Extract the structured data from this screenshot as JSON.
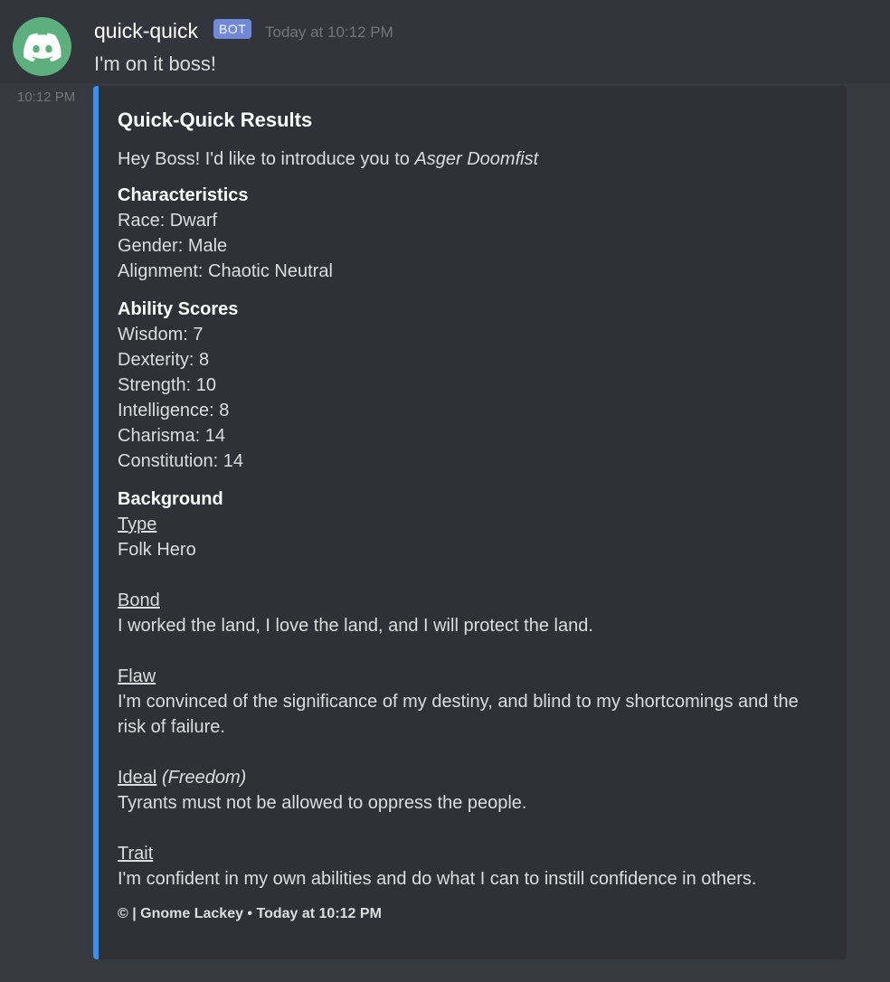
{
  "message": {
    "username": "quick-quick",
    "bot_tag": "BOT",
    "timestamp": "Today at 10:12 PM",
    "text": "I'm on it boss!",
    "side_timestamp": "10:12 PM"
  },
  "embed": {
    "title": "Quick-Quick Results",
    "intro": "Hey Boss! I'd like to introduce you to ",
    "intro_name": "Asger Doomfist",
    "characteristics": {
      "name": "Characteristics",
      "lines": [
        "Race: Dwarf",
        "Gender: Male",
        "Alignment: Chaotic Neutral"
      ]
    },
    "ability_scores": {
      "name": "Ability Scores",
      "lines": [
        "Wisdom: 7",
        "Dexterity: 8",
        "Strength: 10",
        "Intelligence: 8",
        "Charisma: 14",
        "Constitution: 14"
      ]
    },
    "background": {
      "name": "Background",
      "type_label": "Type",
      "type_value": "Folk Hero",
      "bond_label": "Bond",
      "bond_value": "I worked the land, I love the land, and I will protect the land.",
      "flaw_label": "Flaw",
      "flaw_value": "I'm convinced of the significance of my destiny, and blind to my shortcomings and the risk of failure.",
      "ideal_label": "Ideal",
      "ideal_qualifier": "(Freedom)",
      "ideal_value": "Tyrants must not be allowed to oppress the people.",
      "trait_label": "Trait",
      "trait_value": "I'm confident in my own abilities and do what I can to instill confidence in others."
    },
    "footer": "© | Gnome Lackey • Today at 10:12 PM",
    "accent_color": "#3b8ff0"
  },
  "icons": {
    "avatar": "discord-logo-icon"
  }
}
